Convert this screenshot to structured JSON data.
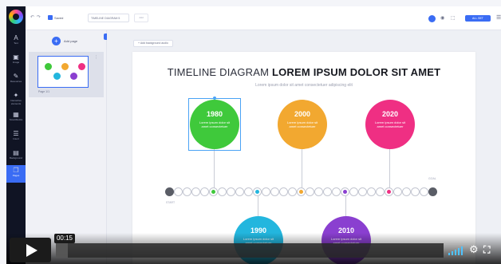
{
  "sidebar": {
    "items": [
      {
        "label": "Text",
        "glyph": "A"
      },
      {
        "label": "Image",
        "glyph": "▣"
      },
      {
        "label": "Resources",
        "glyph": "✎"
      },
      {
        "label": "Interactive elements",
        "glyph": "✦"
      },
      {
        "label": "Smartblocks",
        "glyph": "▦"
      },
      {
        "label": "Insert",
        "glyph": "☰"
      },
      {
        "label": "Background",
        "glyph": "▤"
      },
      {
        "label": "Pages",
        "glyph": "❐"
      }
    ]
  },
  "topbar": {
    "save_label": "Saved",
    "doc_title": "TIMELINE DIAGRAM 5",
    "chip_label": "Add",
    "button_label": "ALL SET"
  },
  "pages_panel": {
    "add_label": "Add page",
    "page_label": "Page 1/1"
  },
  "canvas": {
    "add_background_label": "+ Add background audio",
    "title_light": "TIMELINE DIAGRAM ",
    "title_bold": "LOREM IPSUM DOLOR SIT AMET",
    "subtitle": "Lorem ipsum dolor sit amet consectetuer adipiscing elit",
    "start_label": "START",
    "goal_label": "GOAL",
    "milestones": [
      {
        "year": "1980",
        "text": "Lorem ipsum dolor sit amet consectetuer",
        "color": "#3fc93b"
      },
      {
        "year": "1990",
        "text": "Lorem ipsum dolor sit amet consectetuer",
        "color": "#23b6de"
      },
      {
        "year": "2000",
        "text": "Lorem ipsum dolor sit amet consectetuer",
        "color": "#f2a830"
      },
      {
        "year": "2010",
        "text": "Lorem ipsum dolor sit amet consectetuer",
        "color": "#8a3fd0"
      },
      {
        "year": "2020",
        "text": "Lorem ipsum dolor sit amet consectetuer",
        "color": "#ef2f83"
      }
    ]
  },
  "player": {
    "time": "00:15",
    "progress_fraction": 0.03
  },
  "colors": {
    "accent": "#3a6cf4",
    "sidebar_bg": "#101424",
    "volume": "#4dc3ff"
  }
}
